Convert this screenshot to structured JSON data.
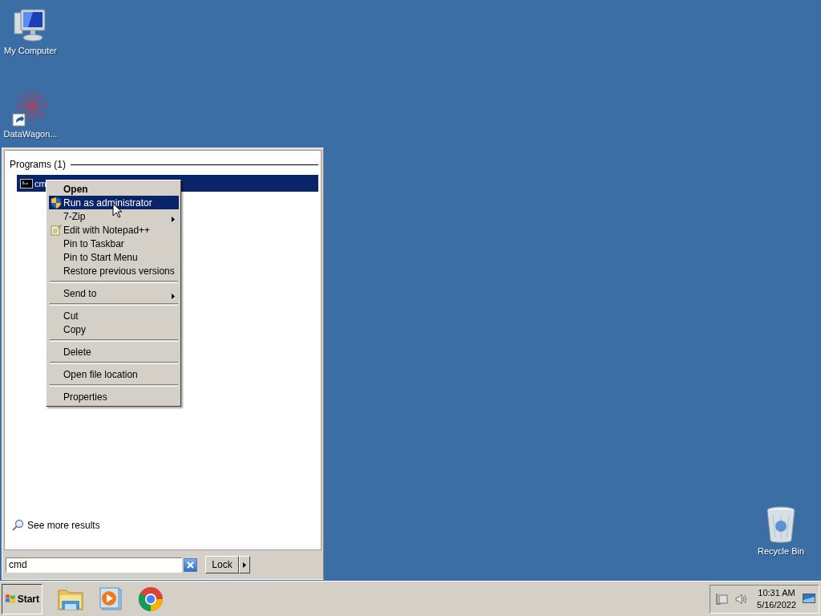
{
  "desktop_icons": [
    {
      "label": "My Computer",
      "kind": "computer"
    },
    {
      "label": "DataWagon...",
      "kind": "shortcut"
    },
    {
      "label": "Recycle Bin",
      "kind": "recycle"
    }
  ],
  "start_menu": {
    "section": "Programs (1)",
    "results": [
      {
        "label": "cm",
        "selected": true
      }
    ],
    "see_more": "See more results",
    "search": {
      "value": "cmd"
    },
    "power_button": "Lock"
  },
  "context_menu": {
    "groups": [
      [
        {
          "label": "Open",
          "kind": "plain",
          "default": true,
          "selected": false,
          "submenu": false
        },
        {
          "label": "Run as administrator",
          "kind": "admin",
          "default": false,
          "selected": true,
          "submenu": false
        },
        {
          "label": "7-Zip",
          "kind": "plain",
          "default": false,
          "selected": false,
          "submenu": true
        },
        {
          "label": "Edit with Notepad++",
          "kind": "editor",
          "default": false,
          "selected": false,
          "submenu": false
        },
        {
          "label": "Pin to Taskbar",
          "kind": "plain",
          "default": false,
          "selected": false,
          "submenu": false
        },
        {
          "label": "Pin to Start Menu",
          "kind": "plain",
          "default": false,
          "selected": false,
          "submenu": false
        },
        {
          "label": "Restore previous versions",
          "kind": "plain",
          "default": false,
          "selected": false,
          "submenu": false
        }
      ],
      [
        {
          "label": "Send to",
          "kind": "plain",
          "default": false,
          "selected": false,
          "submenu": true
        }
      ],
      [
        {
          "label": "Cut",
          "kind": "plain",
          "default": false,
          "selected": false,
          "submenu": false
        },
        {
          "label": "Copy",
          "kind": "plain",
          "default": false,
          "selected": false,
          "submenu": false
        }
      ],
      [
        {
          "label": "Delete",
          "kind": "plain",
          "default": false,
          "selected": false,
          "submenu": false
        }
      ],
      [
        {
          "label": "Open file location",
          "kind": "plain",
          "default": false,
          "selected": false,
          "submenu": false
        }
      ],
      [
        {
          "label": "Properties",
          "kind": "plain",
          "default": false,
          "selected": false,
          "submenu": false
        }
      ]
    ]
  },
  "taskbar": {
    "start": "Start",
    "pinned": [
      {
        "kind": "folder"
      },
      {
        "kind": "media"
      },
      {
        "kind": "browser"
      }
    ],
    "clock": {
      "time": "10:31 AM",
      "date": "5/16/2022"
    }
  }
}
